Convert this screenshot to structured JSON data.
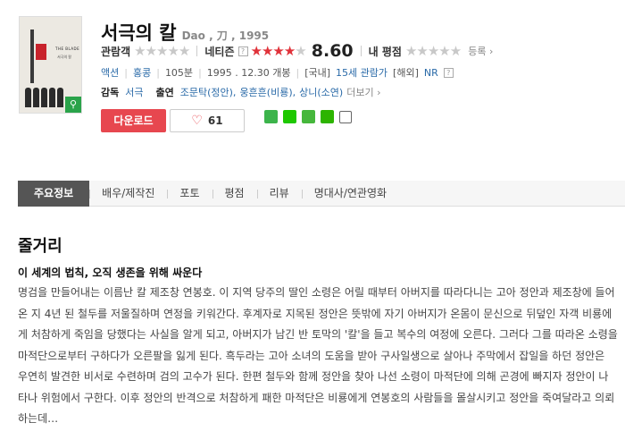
{
  "movie": {
    "title": "서극의 칼",
    "subtitle": "Dao , 刀 , 1995",
    "poster": {
      "title_text": "THE BLADE",
      "subtitle_text": "서극의 칼"
    }
  },
  "ratings": {
    "audience_label": "관람객",
    "netizen_label": "네티즌",
    "netizen_score": "8.60",
    "netizen_stars": 4.3,
    "my_rating_label": "내 평점",
    "register_label": "등록",
    "help_icon": "?"
  },
  "info": {
    "genre": "액션",
    "country": "홍콩",
    "runtime": "105분",
    "release": "1995 . 12.30 개봉",
    "rating_domestic_prefix": "[국내]",
    "rating_domestic": "15세 관람가",
    "rating_foreign_prefix": "[해외]",
    "rating_foreign": "NR"
  },
  "cast": {
    "director_label": "감독",
    "director": "서극",
    "actors_label": "출연",
    "actors": [
      "조문탁(정안),",
      "웅흔흔(비룡),",
      "상니(소연)"
    ],
    "more_label": "더보기"
  },
  "actions": {
    "download_label": "다운로드",
    "like_count": "61"
  },
  "tabs": [
    "주요정보",
    "배우/제작진",
    "포토",
    "평점",
    "리뷰",
    "명대사/연관영화"
  ],
  "synopsis": {
    "section_title": "줄거리",
    "heading": "이 세계의 법칙, 오직 생존을 위해 싸운다",
    "body": "명검을 만들어내는 이름난 칼 제조창 연봉호. 이 지역 당주의 딸인 소령은 어릴 때부터 아버지를 따라다니는 고아 정안과 제조창에 들어온 지 4년 된 철두를 저울질하며 연정을 키워간다. 후계자로 지목된 정안은 뜻밖에 자기 아버지가 온몸이 문신으로 뒤덮인 자객 비룡에게 처참하게 죽임을 당했다는 사실을 알게 되고, 아버지가 남긴 반 토막의 '칼'을 들고 복수의 여정에 오른다. 그러다 그를 따라온 소령을 마적단으로부터 구하다가 오른팔을 잃게 된다. 흑두라는 고아 소녀의 도움을 받아 구사일생으로 살아나 주막에서 잡일을 하던 정안은 우연히 발견한 비서로 수련하며 검의 고수가 된다. 한편 철두와 함께 정안을 찾아 나선 소령이 마적단에 의해 곤경에 빠지자 정안이 나타나 위험에서 구한다. 이후 정안의 반격으로 처참하게 패한 마적단은 비룡에게 연봉호의 사람들을 몰살시키고 정안을 죽여달라고 의뢰하는데…"
  },
  "colors": {
    "accent_red": "#e7474f",
    "link_blue": "#2a6aa8",
    "tab_active": "#555555"
  }
}
